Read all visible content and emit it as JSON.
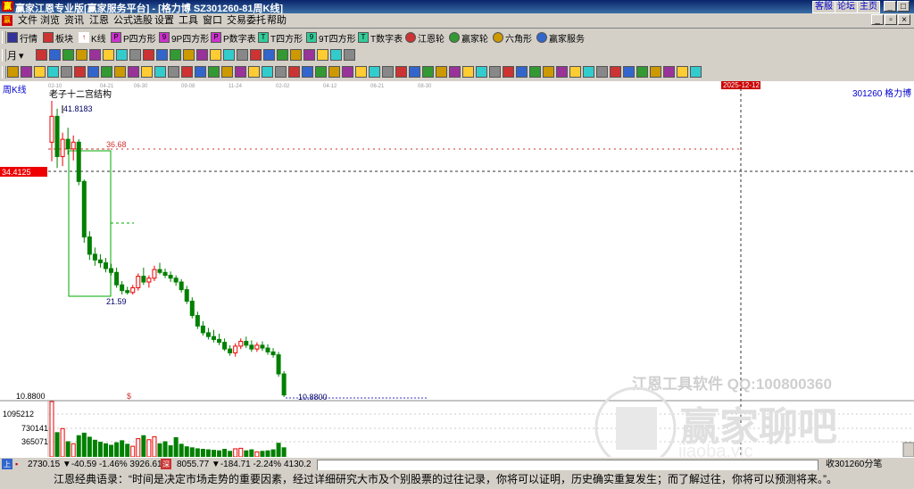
{
  "window": {
    "title": "赢家江恩专业版[赢家服务平台] - [格力博  SZ301260-81周K线]",
    "links": [
      "客服",
      "论坛",
      "主页"
    ]
  },
  "menu": [
    "文件",
    "浏览",
    "资讯",
    "江恩",
    "公式选股",
    "设置",
    "工具",
    "窗口",
    "交易委托",
    "帮助"
  ],
  "toolbar1": [
    "行情",
    "板块",
    "K线",
    "P四方形",
    "9P四方形",
    "P数字表",
    "T四方形",
    "9T四方形",
    "T数字表",
    "江恩轮",
    "赢家轮",
    "六角形",
    "赢家服务"
  ],
  "toolbar2": {
    "period_label": "月"
  },
  "chart": {
    "period_label": "周K线",
    "stock_label": "301260 格力博",
    "indicator_label": "老子十二宫结构",
    "time_ticks": [
      "02-10",
      "04-21",
      "06-30",
      "09-08",
      "11-24",
      "02-02",
      "04-12",
      "06-21",
      "08-30"
    ],
    "cursor_date": "2025-12-12",
    "cursor_price": "34.4125",
    "price_low_label": "10.8800",
    "annotations": {
      "high": "41.8183",
      "level1": "36.68",
      "level2": "21.59",
      "low": "10.8800"
    },
    "dollar_mark": "$",
    "volume_ticks": [
      "1095212",
      "730141",
      "365071"
    ],
    "watermark_top": "江恩工具软件  QQ:100800360",
    "watermark_brand": "赢家聊吧",
    "watermark_url": "jiaoba.yjc"
  },
  "chart_data": {
    "type": "candlestick",
    "title": "老子十二宫结构",
    "xlabel": "",
    "ylabel": "",
    "ylim": [
      10,
      43
    ],
    "levels": [
      41.8183,
      36.68,
      34.4125,
      21.59,
      10.88
    ],
    "ohlc": [
      [
        37.5,
        41.82,
        35.5,
        40.2
      ],
      [
        40.2,
        41.0,
        34.8,
        36.0
      ],
      [
        36.0,
        38.5,
        35.0,
        37.8
      ],
      [
        37.8,
        39.0,
        36.2,
        36.8
      ],
      [
        36.8,
        38.2,
        35.6,
        37.5
      ],
      [
        37.5,
        37.8,
        33.0,
        33.4
      ],
      [
        33.4,
        33.6,
        27.0,
        27.6
      ],
      [
        27.6,
        28.2,
        25.2,
        25.8
      ],
      [
        25.8,
        26.5,
        24.6,
        25.2
      ],
      [
        25.2,
        25.8,
        24.4,
        24.9
      ],
      [
        24.9,
        25.4,
        23.9,
        24.3
      ],
      [
        24.3,
        24.8,
        23.6,
        23.9
      ],
      [
        23.9,
        24.4,
        22.3,
        22.6
      ],
      [
        22.6,
        23.0,
        21.6,
        22.0
      ],
      [
        22.0,
        22.4,
        21.59,
        21.8
      ],
      [
        21.8,
        22.6,
        21.6,
        22.3
      ],
      [
        22.3,
        23.8,
        22.0,
        23.5
      ],
      [
        23.5,
        24.4,
        22.6,
        22.9
      ],
      [
        22.9,
        23.6,
        22.3,
        23.3
      ],
      [
        23.3,
        24.6,
        23.0,
        24.2
      ],
      [
        24.2,
        24.9,
        23.7,
        23.9
      ],
      [
        23.9,
        24.3,
        23.3,
        23.6
      ],
      [
        23.6,
        24.0,
        22.9,
        23.3
      ],
      [
        23.3,
        23.6,
        22.5,
        22.9
      ],
      [
        22.9,
        23.2,
        21.8,
        22.1
      ],
      [
        22.1,
        22.5,
        20.6,
        20.9
      ],
      [
        20.9,
        21.3,
        19.1,
        19.4
      ],
      [
        19.4,
        19.8,
        18.0,
        18.3
      ],
      [
        18.3,
        18.8,
        17.3,
        17.6
      ],
      [
        17.6,
        18.1,
        16.9,
        17.2
      ],
      [
        17.2,
        17.9,
        16.6,
        16.9
      ],
      [
        16.9,
        17.5,
        16.3,
        16.6
      ],
      [
        16.6,
        17.0,
        15.7,
        15.9
      ],
      [
        15.9,
        16.3,
        15.2,
        15.5
      ],
      [
        15.5,
        16.5,
        15.1,
        16.2
      ],
      [
        16.2,
        17.0,
        15.9,
        16.7
      ],
      [
        16.7,
        17.2,
        16.0,
        16.3
      ],
      [
        16.3,
        16.8,
        15.6,
        15.9
      ],
      [
        15.9,
        16.6,
        15.6,
        16.3
      ],
      [
        16.3,
        16.7,
        15.7,
        16.0
      ],
      [
        16.0,
        16.4,
        15.3,
        15.6
      ],
      [
        15.6,
        16.0,
        15.0,
        15.3
      ],
      [
        15.3,
        15.6,
        13.0,
        13.3
      ],
      [
        13.3,
        13.6,
        10.88,
        11.1
      ]
    ],
    "volume": [
      1095212,
      480000,
      560000,
      300000,
      260000,
      420000,
      470000,
      390000,
      330000,
      290000,
      260000,
      230000,
      280000,
      320000,
      250000,
      210000,
      360000,
      420000,
      340000,
      400000,
      260000,
      300000,
      220000,
      380000,
      250000,
      200000,
      180000,
      160000,
      150000,
      140000,
      130000,
      120000,
      150000,
      110000,
      160000,
      170000,
      120000,
      140000,
      100000,
      110000,
      120000,
      140000,
      270000,
      180000
    ]
  },
  "status": {
    "index1_icon": "上",
    "index1": "2730.15 ▼-40.59 -1.46% 3926.61亿",
    "index2_icon": "深",
    "index2": "8055.77 ▼-184.71 -2.24% 4130.2",
    "right": "收301260分笔"
  },
  "quote": "江恩经典语录：“时间是决定市场走势的重要因素，经过详细研究大市及个别股票的过往记录，你将可以证明，历史确实重复发生；而了解过往，你将可以预测将来。”。"
}
